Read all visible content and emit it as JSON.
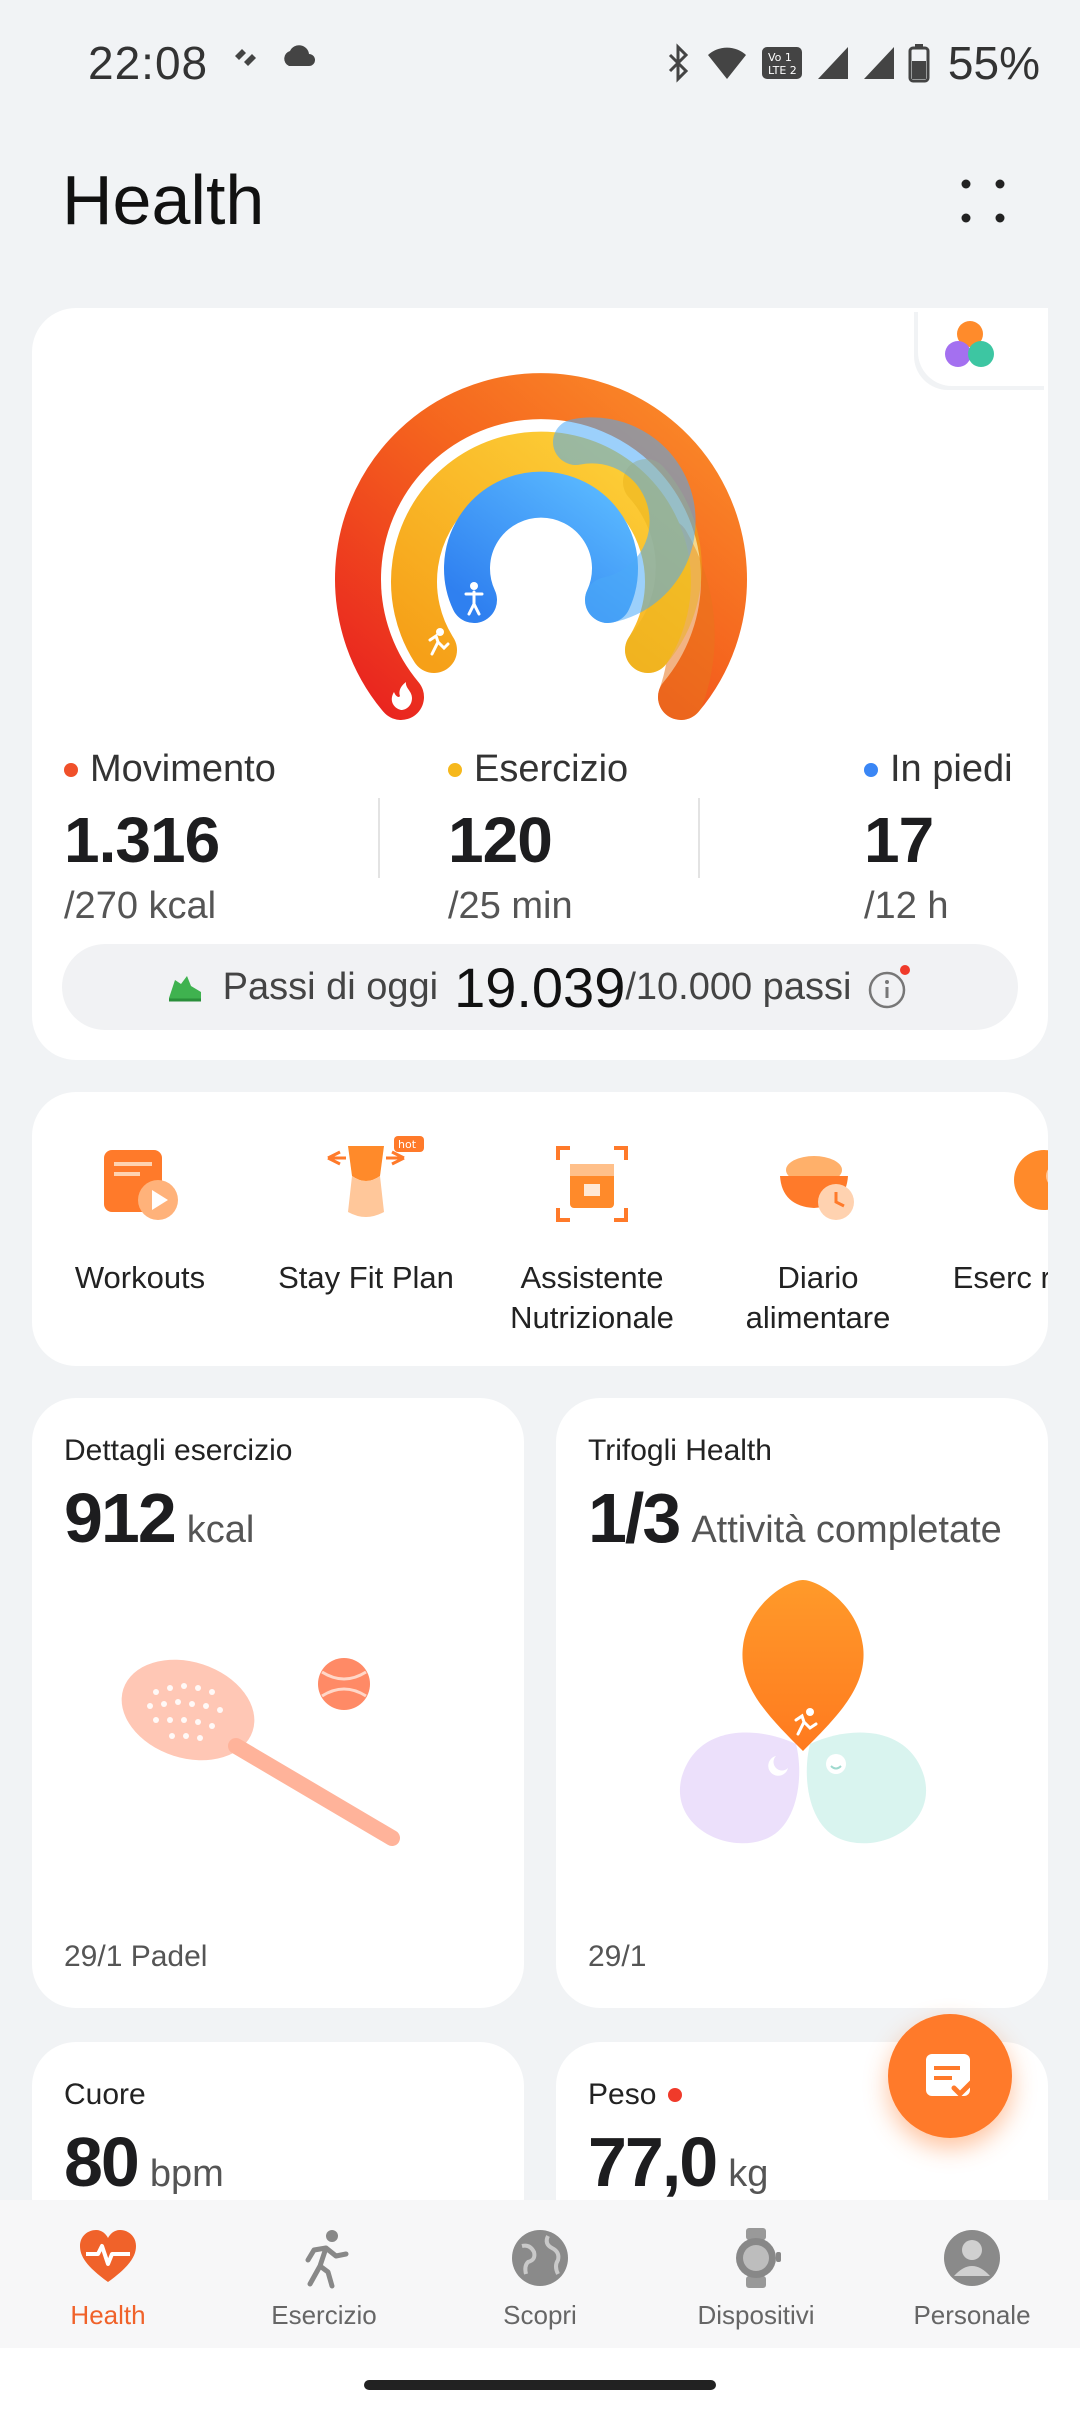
{
  "status": {
    "time": "22:08",
    "battery": "55%"
  },
  "app": {
    "title": "Health"
  },
  "metrics": [
    {
      "label": "Movimento",
      "value": "1.316",
      "goal": "/270 kcal",
      "color": "#f0502a"
    },
    {
      "label": "Esercizio",
      "value": "120",
      "goal": "/25 min",
      "color": "#f6b81c"
    },
    {
      "label": "In piedi",
      "value": "17",
      "goal": "/12 h",
      "color": "#3a86f5"
    }
  ],
  "steps": {
    "label": "Passi di oggi",
    "value": "19.039",
    "goal": "/10.000 passi"
  },
  "shortcuts": [
    {
      "label": "Workouts",
      "icon": "workouts-icon"
    },
    {
      "label": "Stay Fit Plan",
      "icon": "stay-fit-plan-icon",
      "badge": "hot"
    },
    {
      "label": "Assistente Nutrizionale",
      "icon": "nutrition-assistant-icon"
    },
    {
      "label": "Diario alimentare",
      "icon": "food-diary-icon"
    },
    {
      "label": "Eserc respira",
      "icon": "breathing-icon"
    }
  ],
  "tiles": {
    "exercise": {
      "title": "Dettagli esercizio",
      "value": "912",
      "unit": "kcal",
      "footer": "29/1 Padel"
    },
    "trifogli": {
      "title": "Trifogli Health",
      "value": "1/3",
      "unit": "Attività completate",
      "footer": "29/1"
    },
    "heart": {
      "title": "Cuore",
      "value": "80",
      "unit": "bpm"
    },
    "weight": {
      "title": "Peso",
      "value": "77,0",
      "unit": "kg"
    }
  },
  "nav": [
    {
      "label": "Health",
      "icon": "health-heart-icon",
      "active": true
    },
    {
      "label": "Esercizio",
      "icon": "running-icon",
      "active": false
    },
    {
      "label": "Scopri",
      "icon": "globe-icon",
      "active": false
    },
    {
      "label": "Dispositivi",
      "icon": "watch-icon",
      "active": false
    },
    {
      "label": "Personale",
      "icon": "person-icon",
      "active": false
    }
  ]
}
